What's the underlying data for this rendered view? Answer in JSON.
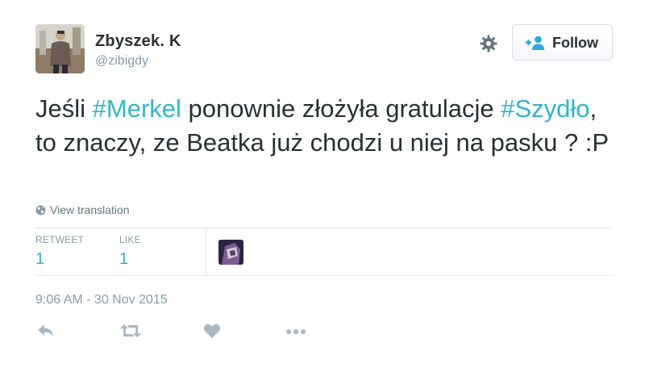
{
  "author": {
    "name": "Zbyszek. K",
    "handle": "@zibigdy"
  },
  "header": {
    "follow_label": "Follow"
  },
  "tweet": {
    "text_parts": [
      {
        "text": "Jeśli ",
        "type": "text"
      },
      {
        "text": "#Merkel",
        "type": "hashtag"
      },
      {
        "text": " ponownie złożyła gratulacje ",
        "type": "text"
      },
      {
        "text": "#Szydło",
        "type": "hashtag"
      },
      {
        "text": ", to znaczy, ze Beatka już chodzi u niej na pasku ? :P",
        "type": "text"
      }
    ],
    "translation_label": "View translation"
  },
  "stats": {
    "retweet_label": "RETWEET",
    "retweet_count": "1",
    "like_label": "LIKE",
    "like_count": "1"
  },
  "timestamp": "9:06 AM - 30 Nov 2015",
  "icons": {
    "settings": "gear-icon",
    "follow": "add-user-icon",
    "translation": "globe-icon",
    "reply": "reply-icon",
    "retweet": "retweet-icon",
    "like": "heart-icon",
    "more": "more-dots-icon"
  },
  "colors": {
    "hashtag": "#2fb7c7",
    "stat_value": "#2fb7c7",
    "muted": "#8899a6",
    "icon": "#aab8c2",
    "text": "#292f33"
  }
}
